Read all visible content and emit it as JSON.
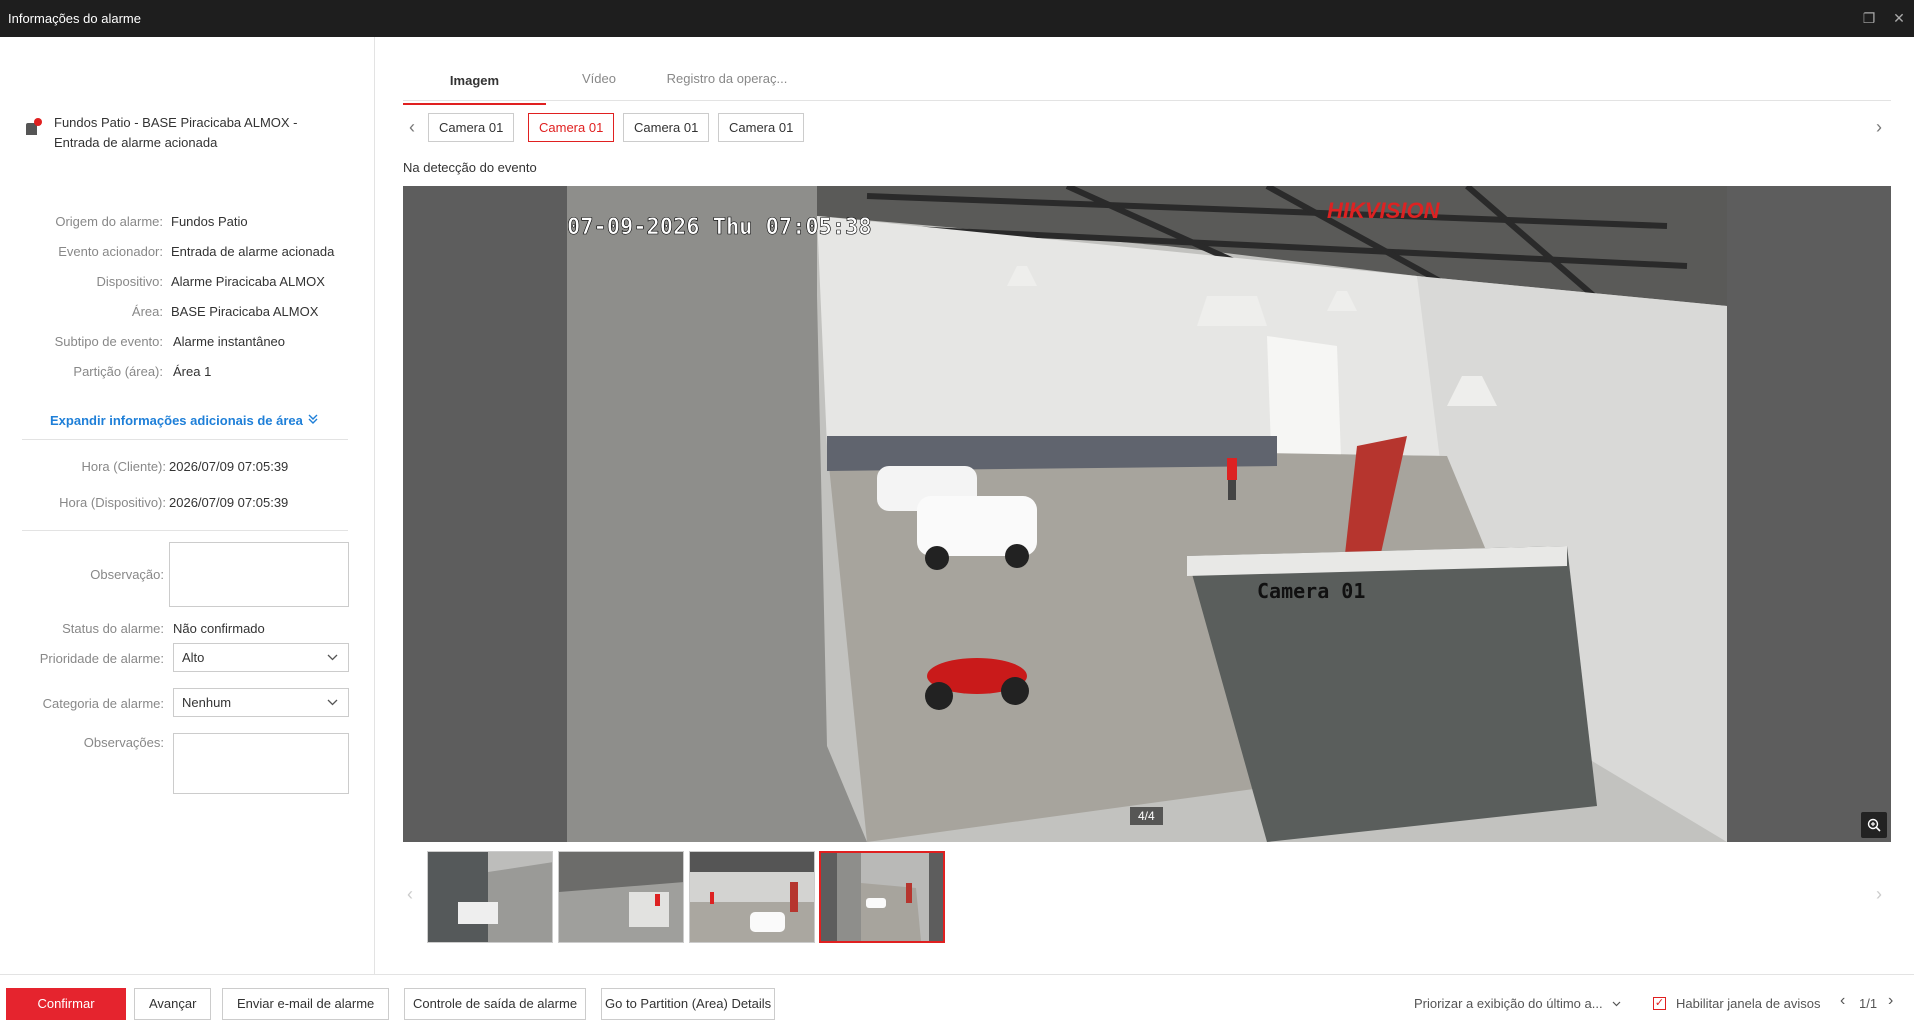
{
  "window": {
    "title": "Informações do alarme",
    "restore_icon": "restore-icon",
    "close_icon": "close-icon"
  },
  "alarm": {
    "title": "Fundos Patio - BASE Piracicaba ALMOX - Entrada de alarme acionada",
    "fields": [
      {
        "label": "Origem do alarme:",
        "value": "Fundos Patio"
      },
      {
        "label": "Evento acionador:",
        "value": "Entrada de alarme acionada"
      },
      {
        "label": "Dispositivo:",
        "value": "Alarme Piracicaba ALMOX"
      },
      {
        "label": "Área:",
        "value": "BASE Piracicaba ALMOX"
      },
      {
        "label": "Subtipo de evento:",
        "value": "Alarme instantâneo"
      },
      {
        "label": "Partição (área):",
        "value": "Área 1"
      }
    ],
    "expand_label": "Expandir informações adicionais de área",
    "times": [
      {
        "label": "Hora (Cliente):",
        "value": "2026/07/09 07:05:39"
      },
      {
        "label": "Hora (Dispositivo):",
        "value": "2026/07/09 07:05:39"
      }
    ]
  },
  "form": {
    "observation_label": "Observação:",
    "observation_value": "",
    "status_label": "Status do alarme:",
    "status_value": "Não confirmado",
    "priority_label": "Prioridade de alarme:",
    "priority_value": "Alto",
    "category_label": "Categoria de alarme:",
    "category_value": "Nenhum",
    "notes_label": "Observações:",
    "notes_value": ""
  },
  "tabs": [
    {
      "label": "Imagem",
      "active": true
    },
    {
      "label": "Vídeo",
      "active": false
    },
    {
      "label": "Registro da operaç...",
      "active": false
    }
  ],
  "cameras": [
    {
      "label": "Camera 01",
      "active": false
    },
    {
      "label": "Camera 01",
      "active": true
    },
    {
      "label": "Camera 01",
      "active": false
    },
    {
      "label": "Camera 01",
      "active": false
    }
  ],
  "viewer": {
    "caption": "Na detecção do evento",
    "osd_timestamp": "07-09-2026 Thu 07:05:38",
    "osd_camera": "Camera 01",
    "brand_watermark": "HIKVISION",
    "counter": "4/4",
    "thumbnail_count": 4,
    "selected_thumbnail": 4
  },
  "footer": {
    "buttons": [
      "Confirmar",
      "Avançar",
      "Enviar e-mail de alarme",
      "Controle de saída de alarme",
      "Go to Partition (Area) Details"
    ],
    "priority_display": "Priorizar a exibição do último a...",
    "enable_popup_label": "Habilitar janela de avisos",
    "enable_popup_checked": true,
    "pager": "1/1"
  },
  "colors": {
    "accent": "#e5242e",
    "link": "#1e7fd8",
    "titlebar": "#1e1e1e"
  }
}
